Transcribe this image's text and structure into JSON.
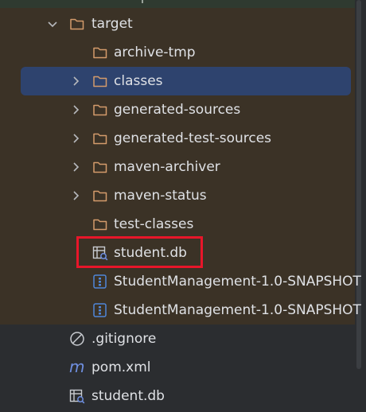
{
  "tree": {
    "target": {
      "label": "target",
      "expanded": true
    },
    "children": [
      {
        "label": "archive-tmp"
      },
      {
        "label": "classes",
        "selected": true
      },
      {
        "label": "generated-sources"
      },
      {
        "label": "generated-test-sources"
      },
      {
        "label": "maven-archiver"
      },
      {
        "label": "maven-status"
      },
      {
        "label": "test-classes"
      },
      {
        "label": "student.db"
      },
      {
        "label": "StudentManagement-1.0-SNAPSHOT"
      },
      {
        "label": "StudentManagement-1.0-SNAPSHOT"
      }
    ],
    "root_files": [
      {
        "label": ".gitignore"
      },
      {
        "label": "pom.xml"
      },
      {
        "label": "student.db"
      }
    ]
  },
  "colors": {
    "folder": "#d49b6b",
    "selection": "#2e436e",
    "highlight": "#e8162a",
    "pom": "#6f8fe0",
    "jar": "#4f86d8"
  },
  "icons": {
    "folder": "folder-icon",
    "chevron_down": "chevron-down-icon",
    "chevron_right": "chevron-right-icon",
    "database": "database-icon",
    "jar": "jar-archive-icon",
    "gitignore": "ignore-file-icon",
    "maven": "maven-pom-icon"
  }
}
